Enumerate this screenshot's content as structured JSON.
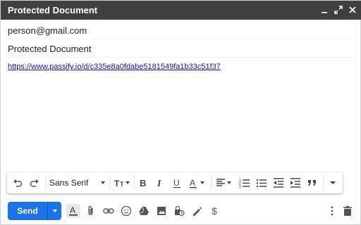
{
  "window": {
    "title": "Protected Document"
  },
  "compose": {
    "to": "person@gmail.com",
    "subject": "Protected Document",
    "body_link": "https://www.passify.io/d/c335e8a0fdabe5181549fa1b33c51f37"
  },
  "toolbar": {
    "font_name": "Sans Serif"
  },
  "actions": {
    "send_label": "Send",
    "price_symbol": "$"
  },
  "colors": {
    "titlebar": "#404040",
    "send_button": "#1a73e8",
    "link": "#1a0dab"
  }
}
